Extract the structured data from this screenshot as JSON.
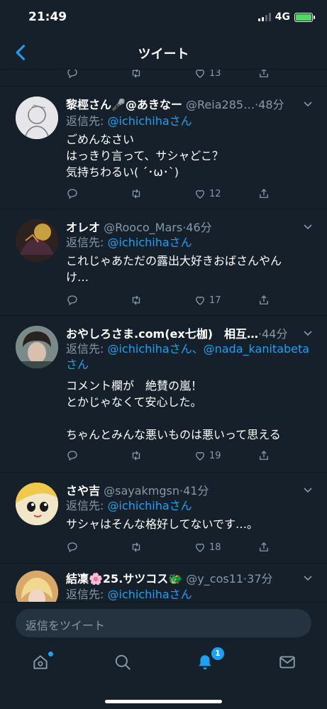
{
  "status": {
    "time": "21:49",
    "network": "4G"
  },
  "header": {
    "title": "ツイート"
  },
  "top_partial_actions": {
    "likes": "13"
  },
  "tweets": [
    {
      "name": "黎桱さん🎤@あきなー",
      "handle": "@Reia285…",
      "time": "48分",
      "reply_label": "返信先: ",
      "reply_mentions": "@ichichihaさん",
      "text": "ごめんなさい\nはっきり言って、サシャどこ？\n気持ちわるい( ´･ω･`)",
      "likes": "12",
      "avatar_color": "#d9d9df"
    },
    {
      "name": "オレオ",
      "handle": "@Rooco_Mars",
      "time": "46分",
      "reply_label": "返信先: ",
      "reply_mentions": "@ichichihaさん",
      "text": "これじゃあただの露出大好きおばさんやん\nけ…",
      "likes": "17",
      "avatar_color": "#5a3a2a"
    },
    {
      "name": "おやしろさま.com(ex七枷)　相互…",
      "handle": "",
      "time": "44分",
      "reply_label": "返信先: ",
      "reply_mentions": "@ichichihaさん、@nada_kanitabeta",
      "reply_mentions_2": "さん",
      "text": "コメント欄が　絶賛の嵐！\nとかじゃなくて安心した。\n\nちゃんとみんな悪いものは悪いって思える",
      "likes": "19",
      "avatar_color": "#6a7a7a"
    },
    {
      "name": "さや吉",
      "handle": "@sayakmgsn",
      "time": "41分",
      "reply_label": "返信先: ",
      "reply_mentions": "@ichichihaさん",
      "text": "サシャはそんな格好してないです…。",
      "likes": "18",
      "avatar_color": "#f3d36a"
    },
    {
      "name": "結凜🌸25.サツコス🐲",
      "handle": "@y_cos11",
      "time": "37分",
      "reply_label": "返信先: ",
      "reply_mentions": "@ichichihaさん",
      "text": "",
      "likes": "",
      "avatar_color": "#e8c28a"
    }
  ],
  "reply_bar": {
    "placeholder": "返信をツイート"
  },
  "tab_bar": {
    "notification_count": "1"
  },
  "colors": {
    "background": "#15202b",
    "accent": "#1da1f2",
    "muted": "#8899a6"
  }
}
